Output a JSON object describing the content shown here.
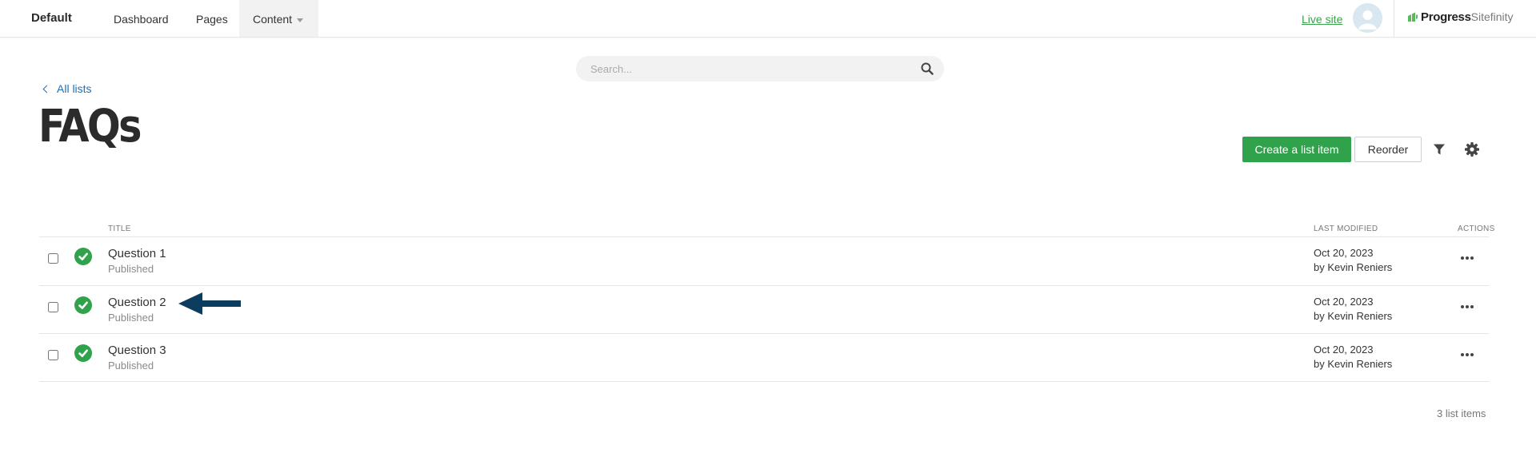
{
  "header": {
    "site_name": "Default",
    "nav": [
      {
        "label": "Dashboard"
      },
      {
        "label": "Pages"
      },
      {
        "label": "Content"
      }
    ],
    "live_site_label": "Live site",
    "brand_part1": "Progress",
    "brand_part2": "Sitefinity"
  },
  "search": {
    "placeholder": "Search...",
    "value": ""
  },
  "back_link": "All lists",
  "page_title": "FAQs",
  "toolbar": {
    "create_label": "Create a list item",
    "reorder_label": "Reorder"
  },
  "table": {
    "columns": {
      "title": "TITLE",
      "last_modified": "LAST MODIFIED",
      "actions": "ACTIONS"
    },
    "rows": [
      {
        "title": "Question 1",
        "status": "Published",
        "date": "Oct 20, 2023",
        "by": "by Kevin Reniers"
      },
      {
        "title": "Question 2",
        "status": "Published",
        "date": "Oct 20, 2023",
        "by": "by Kevin Reniers"
      },
      {
        "title": "Question 3",
        "status": "Published",
        "date": "Oct 20, 2023",
        "by": "by Kevin Reniers"
      }
    ],
    "count_label": "3 list items"
  },
  "colors": {
    "accent_green": "#31a24c",
    "link_blue": "#1f6fb5",
    "arrow_navy": "#0d3d5e"
  },
  "icons": [
    "search-icon",
    "chevron-left-icon",
    "filter-icon",
    "gear-icon",
    "check-circle-icon",
    "more-actions-icon",
    "user-avatar-icon",
    "arrow-left-icon"
  ]
}
